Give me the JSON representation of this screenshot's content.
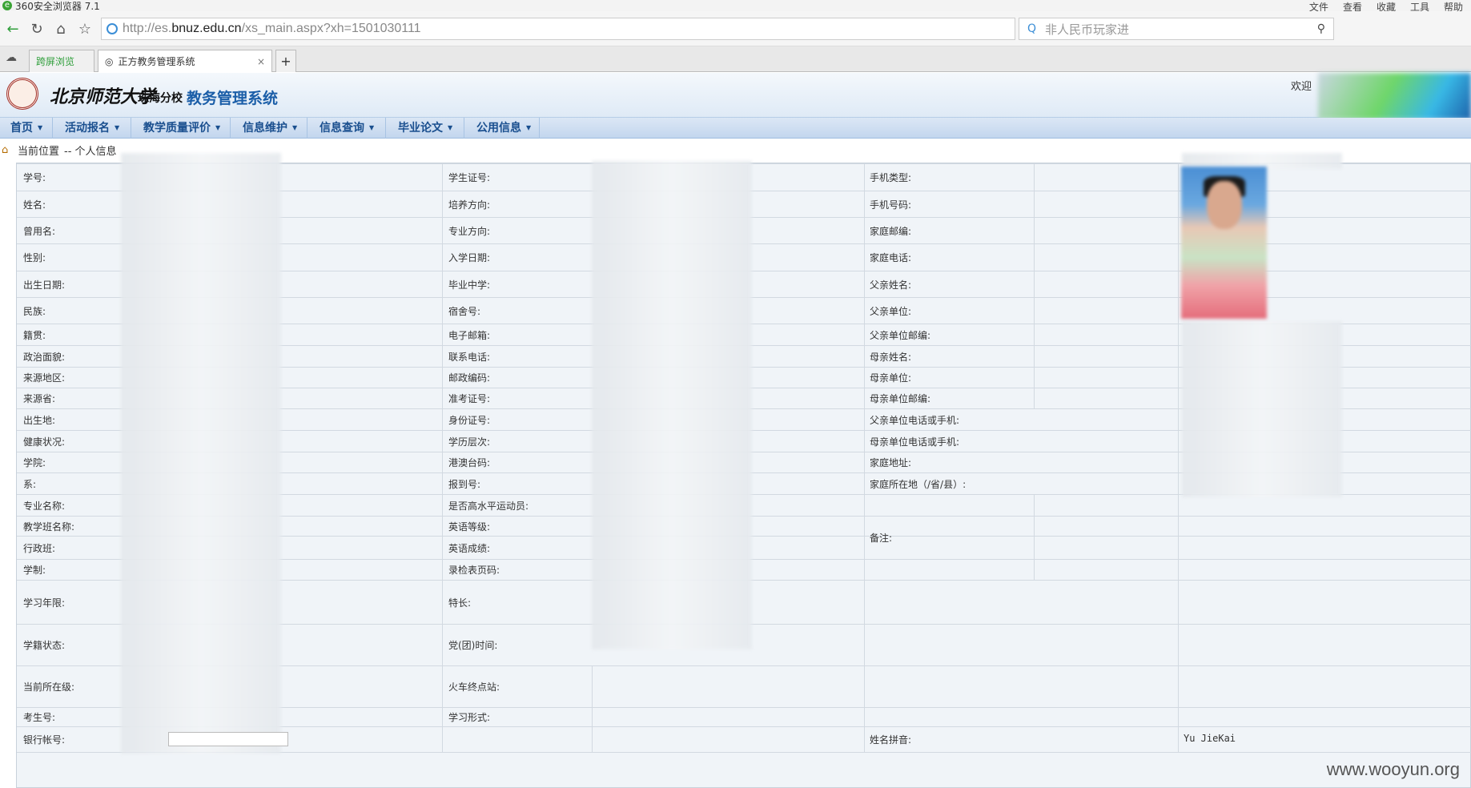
{
  "browser": {
    "window_title": "360安全浏览器 7.1",
    "menu": [
      "文件",
      "查看",
      "收藏",
      "工具",
      "帮助"
    ],
    "url_prefix": "http://es.",
    "url_domain": "bnuz.edu.cn",
    "url_path": "/xs_main.aspx?xh=1501030111",
    "search_placeholder": "非人民币玩家进",
    "tabs": [
      {
        "label": "跨屏浏览"
      },
      {
        "label": "正方教务管理系统"
      }
    ]
  },
  "header": {
    "logo_cn": "北京师范大学",
    "logo_sub": "珠海分校",
    "system_name": "教务管理系统",
    "welcome": "欢迎"
  },
  "menubar": {
    "items": [
      "首页",
      "活动报名",
      "教学质量评价",
      "信息维护",
      "信息查询",
      "毕业论文",
      "公用信息"
    ]
  },
  "breadcrumb": {
    "current_label": "当前位置",
    "path": "-- 个人信息"
  },
  "form": {
    "col1_labels": [
      "学号:",
      "姓名:",
      "曾用名:",
      "性别:",
      "出生日期:",
      "民族:",
      "籍贯:",
      "政治面貌:",
      "来源地区:",
      "来源省:",
      "出生地:",
      "健康状况:",
      "学院:",
      "系:",
      "专业名称:",
      "教学班名称:",
      "行政班:",
      "学制:",
      "学习年限:",
      "学籍状态:",
      "当前所在级:",
      "考生号:",
      "银行帐号:"
    ],
    "col2_labels": [
      "学生证号:",
      "培养方向:",
      "专业方向:",
      "入学日期:",
      "毕业中学:",
      "宿舍号:",
      "电子邮箱:",
      "联系电话:",
      "邮政编码:",
      "准考证号:",
      "身份证号:",
      "学历层次:",
      "港澳台码:",
      "报到号:",
      "是否高水平运动员:",
      "英语等级:",
      "英语成绩:",
      "录检表页码:",
      "特长:",
      "党(团)时间:",
      "火车终点站:",
      "学习形式:"
    ],
    "col3_labels": [
      "手机类型:",
      "手机号码:",
      "家庭邮编:",
      "家庭电话:",
      "父亲姓名:",
      "父亲单位:",
      "父亲单位邮编:",
      "母亲姓名:",
      "母亲单位:",
      "母亲单位邮编:",
      "父亲单位电话或手机:",
      "母亲单位电话或手机:",
      "家庭地址:",
      "家庭所在地（/省/县）:",
      "备注:"
    ],
    "pinyin_label": "姓名拼音:",
    "pinyin_value": "Yu JieKai"
  },
  "watermark": "www.wooyun.org"
}
